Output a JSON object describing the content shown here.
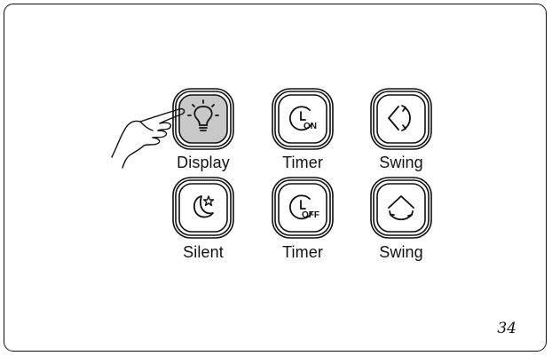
{
  "buttons": [
    {
      "id": "display",
      "label": "Display",
      "icon": "bulb-icon",
      "highlighted": true
    },
    {
      "id": "timer-on",
      "label": "Timer",
      "icon": "clock-icon",
      "badge": "ON"
    },
    {
      "id": "swing-horizontal",
      "label": "Swing",
      "icon": "swing-horizontal-icon"
    },
    {
      "id": "silent",
      "label": "Silent",
      "icon": "moon-star-icon"
    },
    {
      "id": "timer-off",
      "label": "Timer",
      "icon": "clock-icon",
      "badge": "OFF"
    },
    {
      "id": "swing-vertical",
      "label": "Swing",
      "icon": "swing-vertical-icon"
    }
  ],
  "page_number": "34",
  "colors": {
    "line": "#111111",
    "highlight_fill": "#c8c8c8",
    "background": "#ffffff"
  }
}
